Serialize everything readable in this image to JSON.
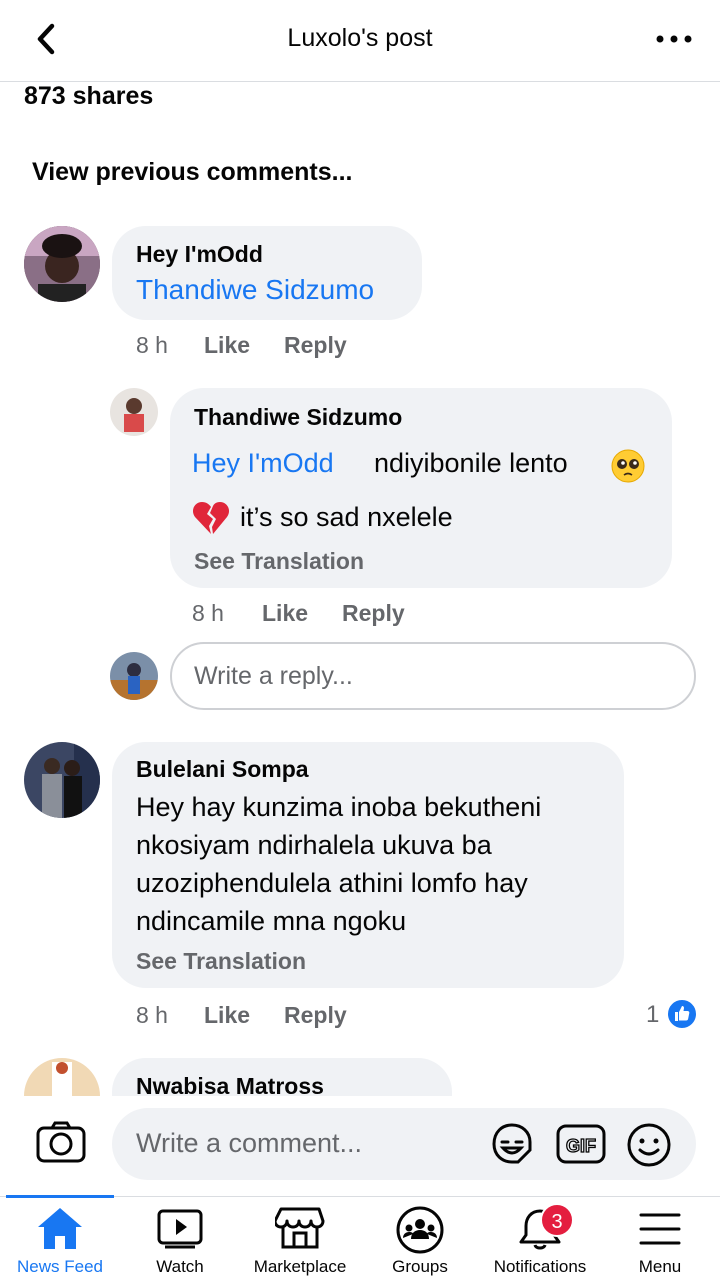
{
  "header": {
    "title": "Luxolo's post"
  },
  "post": {
    "shares": "873 shares",
    "view_previous": "View previous comments..."
  },
  "comments": [
    {
      "author": "Hey I'mOdd",
      "mention": "Thandiwe Sidzumo",
      "time": "8 h",
      "like": "Like",
      "reply": "Reply",
      "replies": [
        {
          "author": "Thandiwe Sidzumo",
          "mention": "Hey I'mOdd",
          "text_line1": "ndiyibonile lento",
          "text_line2": "it’s so sad nxelele",
          "see_translation": "See Translation",
          "time": "8 h",
          "like": "Like",
          "reply": "Reply"
        }
      ],
      "reply_placeholder": "Write a reply..."
    },
    {
      "author": "Bulelani Sompa",
      "lines": [
        "Hey hay kunzima inoba bekutheni",
        "nkosiyam ndirhalela ukuva ba",
        "uzoziphendulela athini lomfo hay",
        "ndincamile mna ngoku"
      ],
      "see_translation": "See Translation",
      "time": "8 h",
      "like": "Like",
      "reply": "Reply",
      "reaction_count": "1"
    },
    {
      "author": "Nwabisa Matross"
    }
  ],
  "composer": {
    "placeholder": "Write a comment..."
  },
  "tabs": [
    {
      "label": "News Feed",
      "icon": "home-icon",
      "active": true
    },
    {
      "label": "Watch",
      "icon": "watch-icon"
    },
    {
      "label": "Marketplace",
      "icon": "marketplace-icon"
    },
    {
      "label": "Groups",
      "icon": "groups-icon"
    },
    {
      "label": "Notifications",
      "icon": "bell-icon",
      "badge": "3"
    },
    {
      "label": "Menu",
      "icon": "menu-icon"
    }
  ],
  "colors": {
    "accent": "#1877f2",
    "bubble": "#f0f2f5",
    "muted": "#65676b",
    "badge": "#e41e3f"
  }
}
